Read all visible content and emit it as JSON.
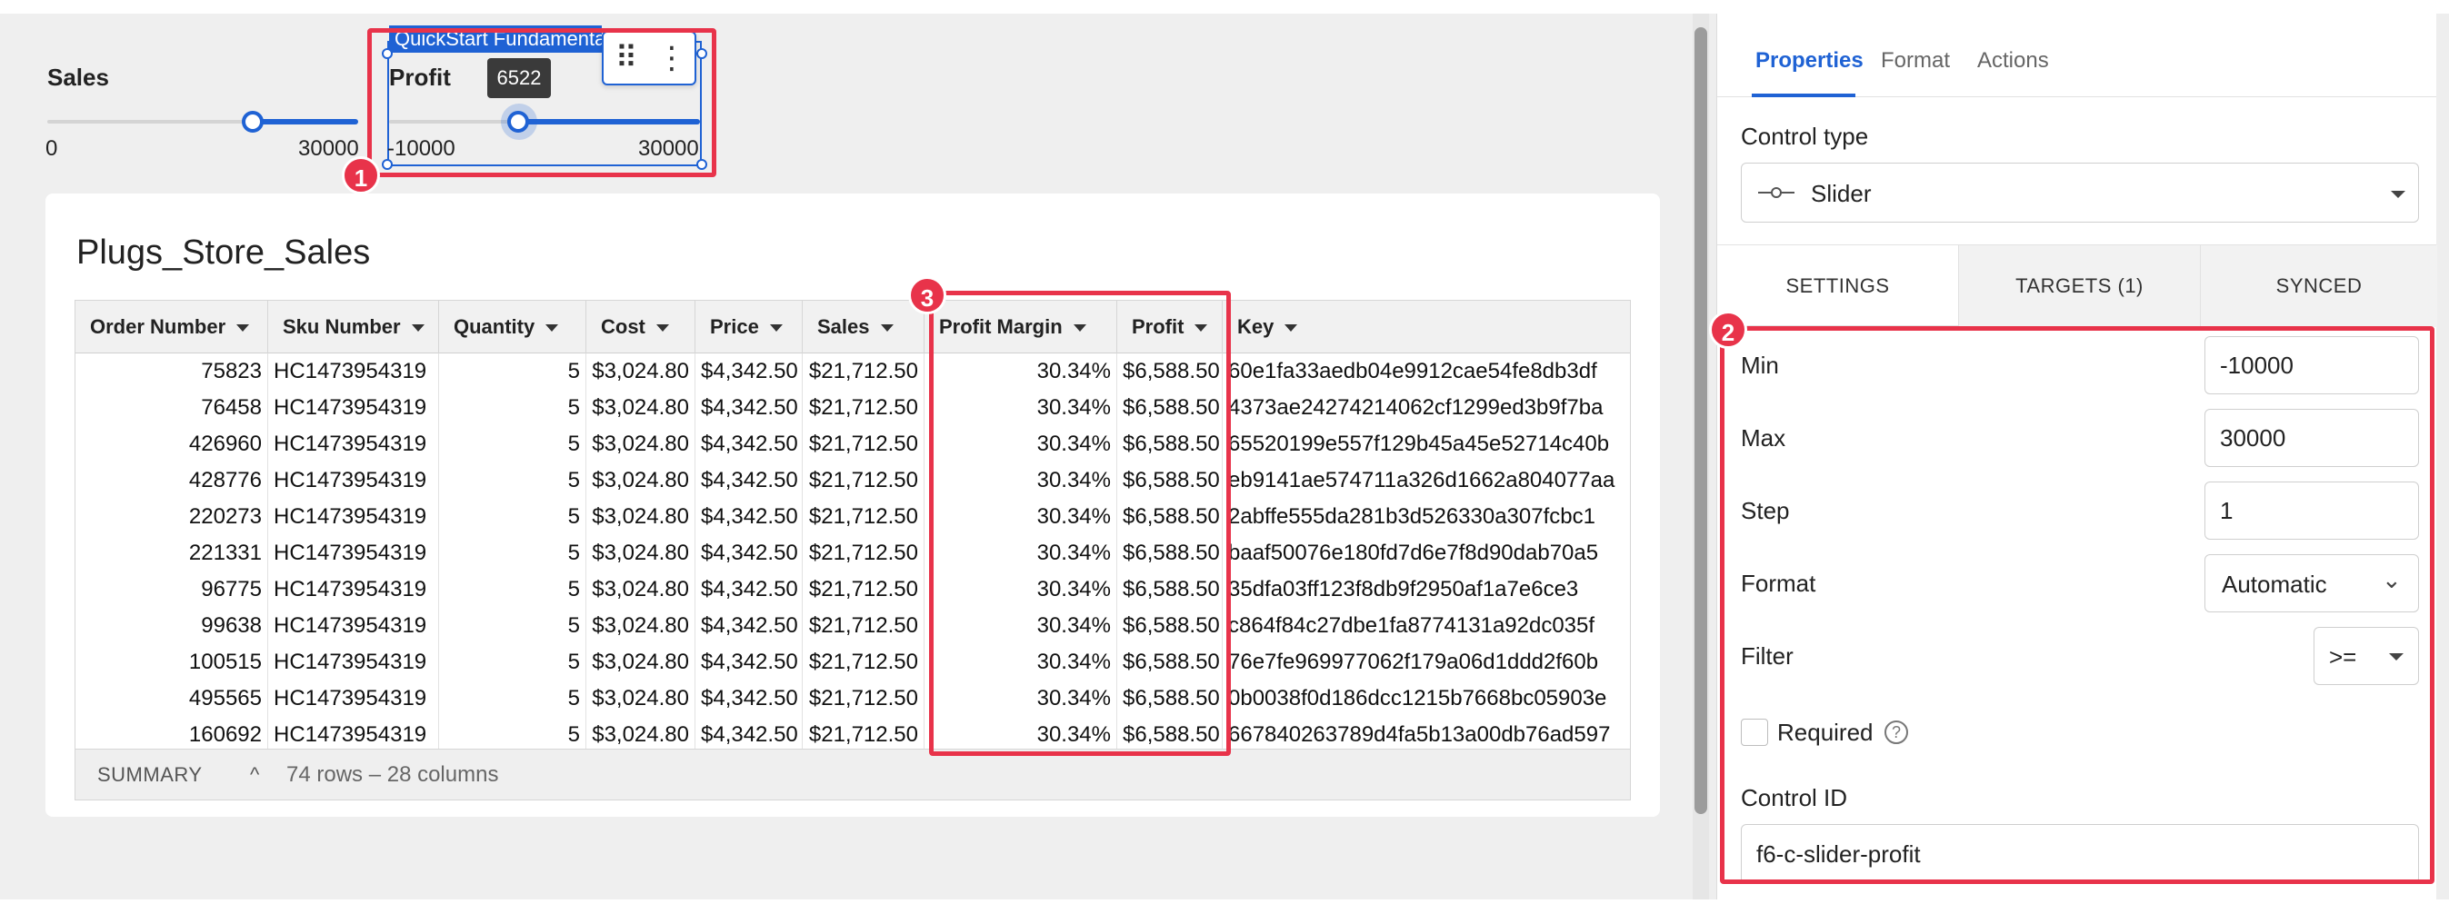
{
  "sliders": {
    "sales": {
      "label": "Sales",
      "min": "0",
      "max": "30000"
    },
    "profit": {
      "label": "Profit",
      "min": "-10000",
      "max": "30000",
      "tooltip": "6522",
      "element_tag": "QuickStart Fundamentals"
    }
  },
  "toolbar": {
    "drag_glyph": "⠿",
    "more_glyph": "⋮"
  },
  "callouts": [
    "1",
    "2",
    "3"
  ],
  "table": {
    "title": "Plugs_Store_Sales",
    "columns": [
      "Order Number",
      "Sku Number",
      "Quantity",
      "Cost",
      "Price",
      "Sales",
      "Profit Margin",
      "Profit",
      "Key"
    ],
    "rows": [
      [
        "75823",
        "HC1473954319",
        "5",
        "$3,024.80",
        "$4,342.50",
        "$21,712.50",
        "30.34%",
        "$6,588.50",
        "60e1fa33aedb04e9912cae54fe8db3df"
      ],
      [
        "76458",
        "HC1473954319",
        "5",
        "$3,024.80",
        "$4,342.50",
        "$21,712.50",
        "30.34%",
        "$6,588.50",
        "4373ae24274214062cf1299ed3b9f7ba"
      ],
      [
        "426960",
        "HC1473954319",
        "5",
        "$3,024.80",
        "$4,342.50",
        "$21,712.50",
        "30.34%",
        "$6,588.50",
        "65520199e557f129b45a45e52714c40b"
      ],
      [
        "428776",
        "HC1473954319",
        "5",
        "$3,024.80",
        "$4,342.50",
        "$21,712.50",
        "30.34%",
        "$6,588.50",
        "eb9141ae574711a326d1662a804077aa"
      ],
      [
        "220273",
        "HC1473954319",
        "5",
        "$3,024.80",
        "$4,342.50",
        "$21,712.50",
        "30.34%",
        "$6,588.50",
        "2abffe555da281b3d526330a307fcbc1"
      ],
      [
        "221331",
        "HC1473954319",
        "5",
        "$3,024.80",
        "$4,342.50",
        "$21,712.50",
        "30.34%",
        "$6,588.50",
        "baaf50076e180fd7d6e7f8d90dab70a5"
      ],
      [
        "96775",
        "HC1473954319",
        "5",
        "$3,024.80",
        "$4,342.50",
        "$21,712.50",
        "30.34%",
        "$6,588.50",
        "35dfa03ff123f8db9f2950af1a7e6ce3"
      ],
      [
        "99638",
        "HC1473954319",
        "5",
        "$3,024.80",
        "$4,342.50",
        "$21,712.50",
        "30.34%",
        "$6,588.50",
        "c864f84c27dbe1fa8774131a92dc035f"
      ],
      [
        "100515",
        "HC1473954319",
        "5",
        "$3,024.80",
        "$4,342.50",
        "$21,712.50",
        "30.34%",
        "$6,588.50",
        "76e7fe969977062f179a06d1ddd2f60b"
      ],
      [
        "495565",
        "HC1473954319",
        "5",
        "$3,024.80",
        "$4,342.50",
        "$21,712.50",
        "30.34%",
        "$6,588.50",
        "0b0038f0d186dcc1215b7668bc05903e"
      ],
      [
        "160692",
        "HC1473954319",
        "5",
        "$3,024.80",
        "$4,342.50",
        "$21,712.50",
        "30.34%",
        "$6,588.50",
        "667840263789d4fa5b13a00db76ad597"
      ]
    ],
    "summary_label": "SUMMARY",
    "summary_info": "74 rows – 28 columns"
  },
  "panel": {
    "tabs": [
      "Properties",
      "Format",
      "Actions"
    ],
    "control_type_label": "Control type",
    "control_type_value": "Slider",
    "subtabs": [
      "SETTINGS",
      "TARGETS (1)",
      "SYNCED"
    ],
    "min_label": "Min",
    "min_value": "-10000",
    "max_label": "Max",
    "max_value": "30000",
    "step_label": "Step",
    "step_value": "1",
    "format_label": "Format",
    "format_value": "Automatic",
    "filter_label": "Filter",
    "filter_value": ">=",
    "required_label": "Required",
    "help_glyph": "?",
    "control_id_label": "Control ID",
    "control_id_value": "f6-c-slider-profit"
  },
  "colors": {
    "accent": "#1f62d4",
    "callout": "#e8334a"
  }
}
